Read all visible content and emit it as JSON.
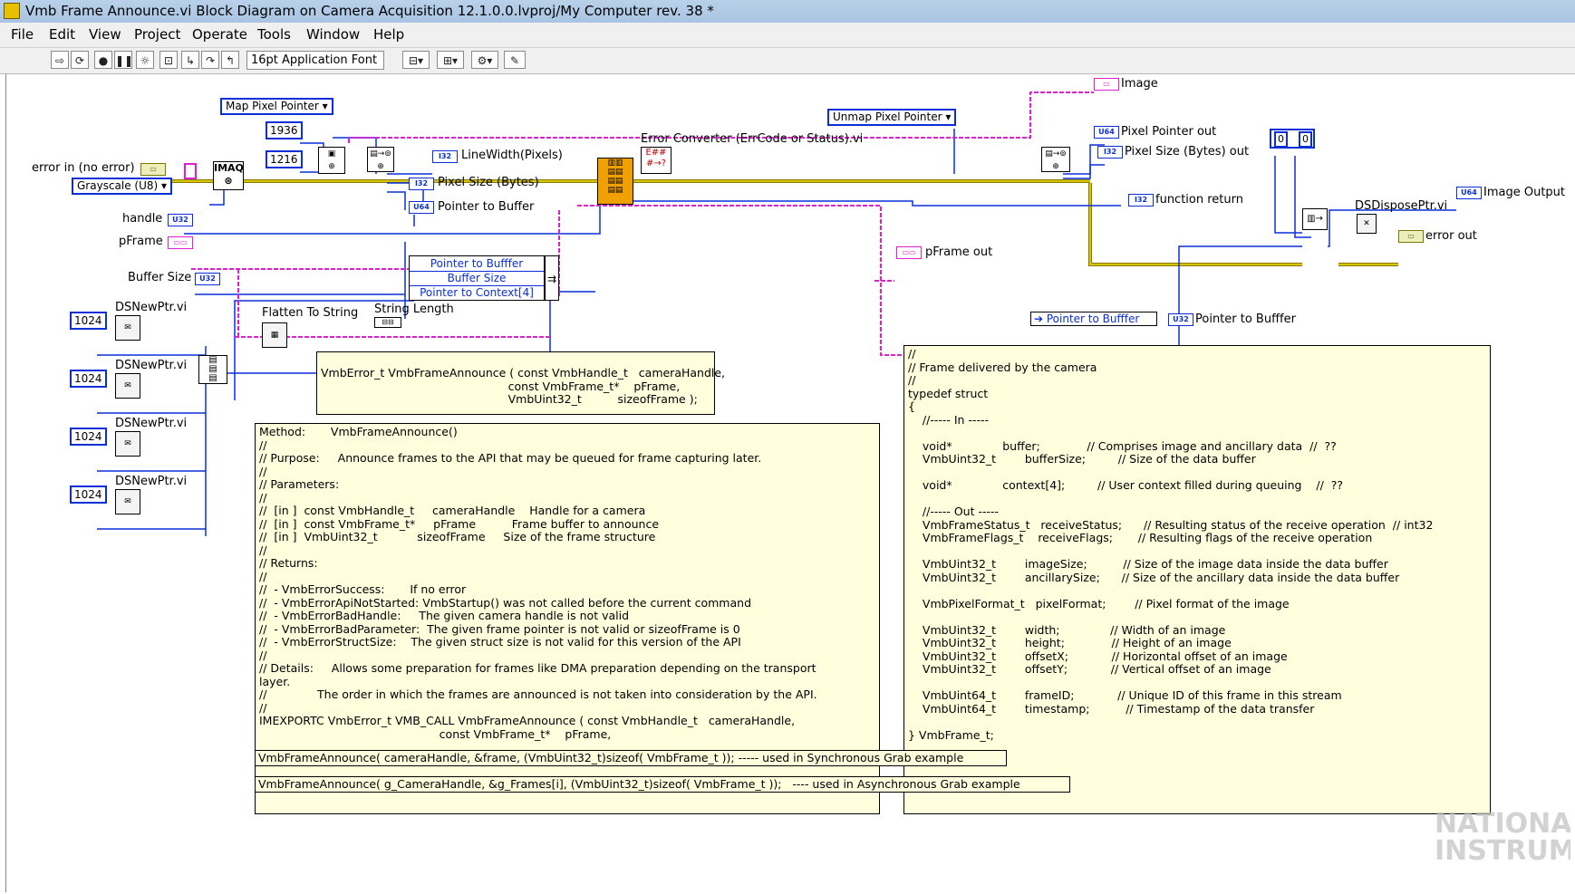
{
  "window": {
    "title": "Vmb Frame Announce.vi Block Diagram on Camera Acquisition 12.1.0.0.lvproj/My Computer rev. 38 *"
  },
  "menu": [
    "File",
    "Edit",
    "View",
    "Project",
    "Operate",
    "Tools",
    "Window",
    "Help"
  ],
  "toolbar": {
    "font": "16pt Application Font"
  },
  "diagram": {
    "error_in": "error in (no error)",
    "grayscale": "Grayscale (U8)",
    "imaq": "IMAQ",
    "width_const": "1936",
    "height_const": "1216",
    "map_pointer": "Map Pixel Pointer",
    "unmap_pointer": "Unmap Pixel Pointer",
    "linewidth": "LineWidth(Pixels)",
    "pixel_size_bytes": "Pixel Size (Bytes)",
    "pointer_to_buffer": "Pointer to Buffer",
    "handle": "handle",
    "pframe": "pFrame",
    "buffer_size": "Buffer Size",
    "bundle_rows": [
      "Pointer to Bufffer",
      "Buffer Size",
      "Pointer to Context[4]"
    ],
    "flatten": "Flatten To String",
    "strlen": "String Length",
    "ds_new_ptr": "DSNewPtr.vi",
    "const_1024": "1024",
    "error_converter": "Error Converter (ErrCode or Status).vi",
    "image": "Image",
    "pixel_pointer_out": "Pixel Pointer out",
    "pixel_size_out": "Pixel Size (Bytes) out",
    "function_return": "function return",
    "pframe_out": "pFrame out",
    "unbundle_label": "Pointer to Bufffer",
    "pointer_to_bufffer_out": "Pointer to Bufffer",
    "zero_a": "0",
    "zero_b": "0",
    "ds_dispose": "DSDisposePtr.vi",
    "image_output": "Image Output",
    "error_out": "error out",
    "tags": {
      "u32": "U32",
      "u64": "U64",
      "i32": "I32"
    }
  },
  "comments": {
    "signature": "VmbError_t VmbFrameAnnounce ( const VmbHandle_t   cameraHandle,\n                                                    const VmbFrame_t*    pFrame,\n                                                    VmbUint32_t          sizeofFrame );",
    "method": "Method:       VmbFrameAnnounce()\n//\n// Purpose:     Announce frames to the API that may be queued for frame capturing later.\n//\n// Parameters:\n//\n//  [in ]  const VmbHandle_t     cameraHandle    Handle for a camera\n//  [in ]  const VmbFrame_t*     pFrame          Frame buffer to announce\n//  [in ]  VmbUint32_t           sizeofFrame     Size of the frame structure\n//\n// Returns:\n//\n//  - VmbErrorSuccess:       If no error\n//  - VmbErrorApiNotStarted: VmbStartup() was not called before the current command\n//  - VmbErrorBadHandle:     The given camera handle is not valid\n//  - VmbErrorBadParameter:  The given frame pointer is not valid or sizeofFrame is 0\n//  - VmbErrorStructSize:    The given struct size is not valid for this version of the API\n//\n// Details:     Allows some preparation for frames like DMA preparation depending on the transport\nlayer.\n//              The order in which the frames are announced is not taken into consideration by the API.\n//\nIMEXPORTC VmbError_t VMB_CALL VmbFrameAnnounce ( const VmbHandle_t   cameraHandle,\n                                                  const VmbFrame_t*    pFrame,",
    "struct": "//\n// Frame delivered by the camera\n//\ntypedef struct\n{\n    //----- In -----\n\n    void*              buffer;             // Comprises image and ancillary data  //  ??\n    VmbUint32_t        bufferSize;         // Size of the data buffer\n\n    void*              context[4];         // User context filled during queuing    //  ??\n\n    //----- Out -----\n    VmbFrameStatus_t   receiveStatus;      // Resulting status of the receive operation  // int32\n    VmbFrameFlags_t    receiveFlags;       // Resulting flags of the receive operation\n\n    VmbUint32_t        imageSize;          // Size of the image data inside the data buffer\n    VmbUint32_t        ancillarySize;      // Size of the ancillary data inside the data buffer\n\n    VmbPixelFormat_t   pixelFormat;        // Pixel format of the image\n\n    VmbUint32_t        width;              // Width of an image\n    VmbUint32_t        height;             // Height of an image\n    VmbUint32_t        offsetX;            // Horizontal offset of an image\n    VmbUint32_t        offsetY;            // Vertical offset of an image\n\n    VmbUint64_t        frameID;            // Unique ID of this frame in this stream\n    VmbUint64_t        timestamp;          // Timestamp of the data transfer\n\n} VmbFrame_t;",
    "sync": "VmbFrameAnnounce( cameraHandle, &frame, (VmbUint32_t)sizeof( VmbFrame_t )); ----- used in Synchronous Grab example",
    "async": "VmbFrameAnnounce( g_CameraHandle, &g_Frames[i], (VmbUint32_t)sizeof( VmbFrame_t ));   ---- used in Asynchronous Grab example"
  },
  "watermark": "NATIONAL INSTRUMENTS"
}
